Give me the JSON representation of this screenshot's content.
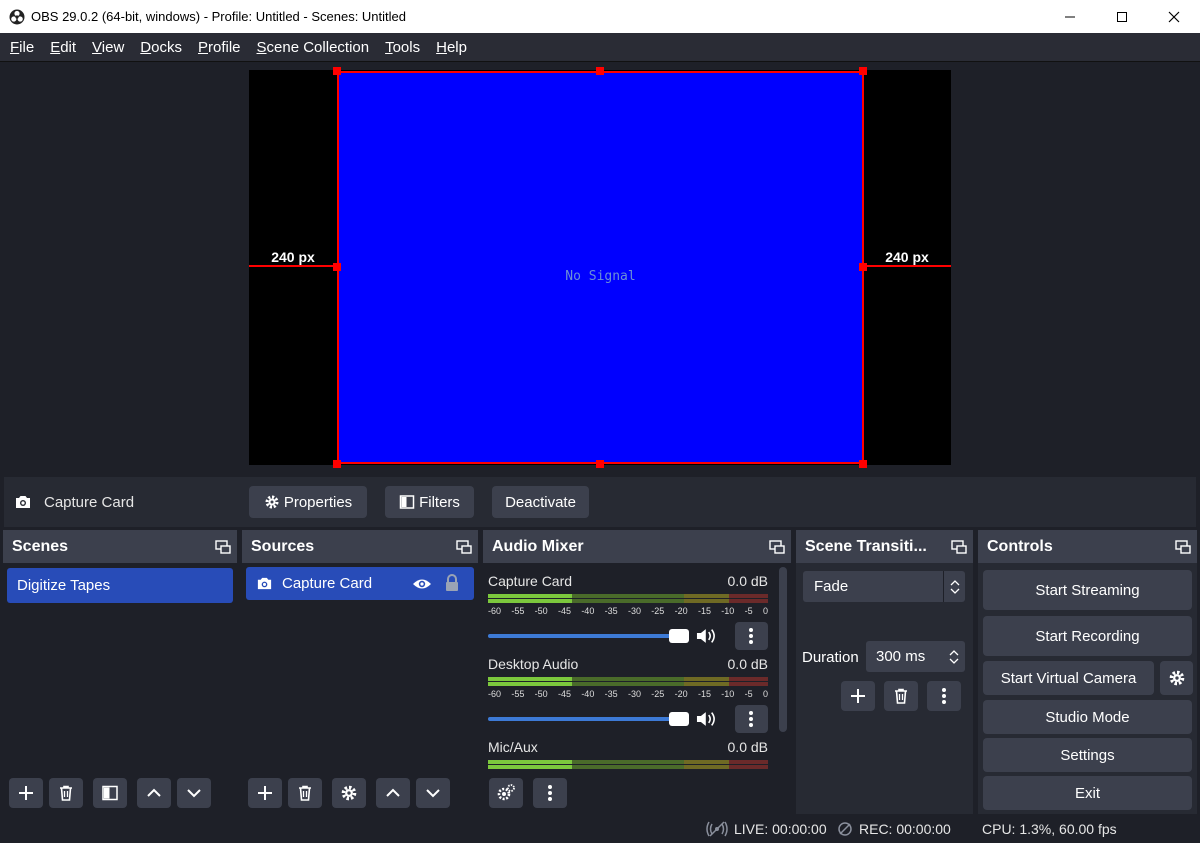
{
  "window": {
    "title": "OBS 29.0.2 (64-bit, windows) - Profile: Untitled - Scenes: Untitled",
    "min_glyph": "—",
    "max_glyph": "☐",
    "close_glyph": "✕"
  },
  "menu": [
    {
      "accel": "F",
      "rest": "ile"
    },
    {
      "accel": "E",
      "rest": "dit"
    },
    {
      "accel": "V",
      "rest": "iew"
    },
    {
      "accel": "D",
      "rest": "ocks"
    },
    {
      "accel": "P",
      "rest": "rofile"
    },
    {
      "accel": "S",
      "rest": "cene Collection"
    },
    {
      "accel": "T",
      "rest": "ools"
    },
    {
      "accel": "H",
      "rest": "elp"
    }
  ],
  "preview": {
    "no_signal": "No Signal",
    "left_margin": "240 px",
    "right_margin": "240 px",
    "source_color": "#0000ff",
    "selection_color": "#ff0000"
  },
  "source_bar": {
    "source_name": "Capture Card",
    "properties": "Properties",
    "filters": "Filters",
    "deactivate": "Deactivate"
  },
  "docks": {
    "scenes": {
      "title": "Scenes",
      "items": [
        "Digitize Tapes"
      ]
    },
    "sources": {
      "title": "Sources",
      "items": [
        "Capture Card"
      ]
    },
    "mixer": {
      "title": "Audio Mixer",
      "channels": [
        {
          "name": "Capture Card",
          "level": "0.0 dB"
        },
        {
          "name": "Desktop Audio",
          "level": "0.0 dB"
        },
        {
          "name": "Mic/Aux",
          "level": "0.0 dB"
        }
      ],
      "scale": [
        "-60",
        "-55",
        "-50",
        "-45",
        "-40",
        "-35",
        "-30",
        "-25",
        "-20",
        "-15",
        "-10",
        "-5",
        "0"
      ]
    },
    "transitions": {
      "title": "Scene Transiti...",
      "selected": "Fade",
      "duration_label": "Duration",
      "duration_value": "300 ms"
    },
    "controls": {
      "title": "Controls",
      "start_streaming": "Start Streaming",
      "start_recording": "Start Recording",
      "start_virtual_camera": "Start Virtual Camera",
      "studio_mode": "Studio Mode",
      "settings": "Settings",
      "exit": "Exit"
    }
  },
  "status": {
    "live": "LIVE: 00:00:00",
    "rec": "REC: 00:00:00",
    "cpu": "CPU: 1.3%, 60.00 fps"
  },
  "accent": "#284cb8"
}
